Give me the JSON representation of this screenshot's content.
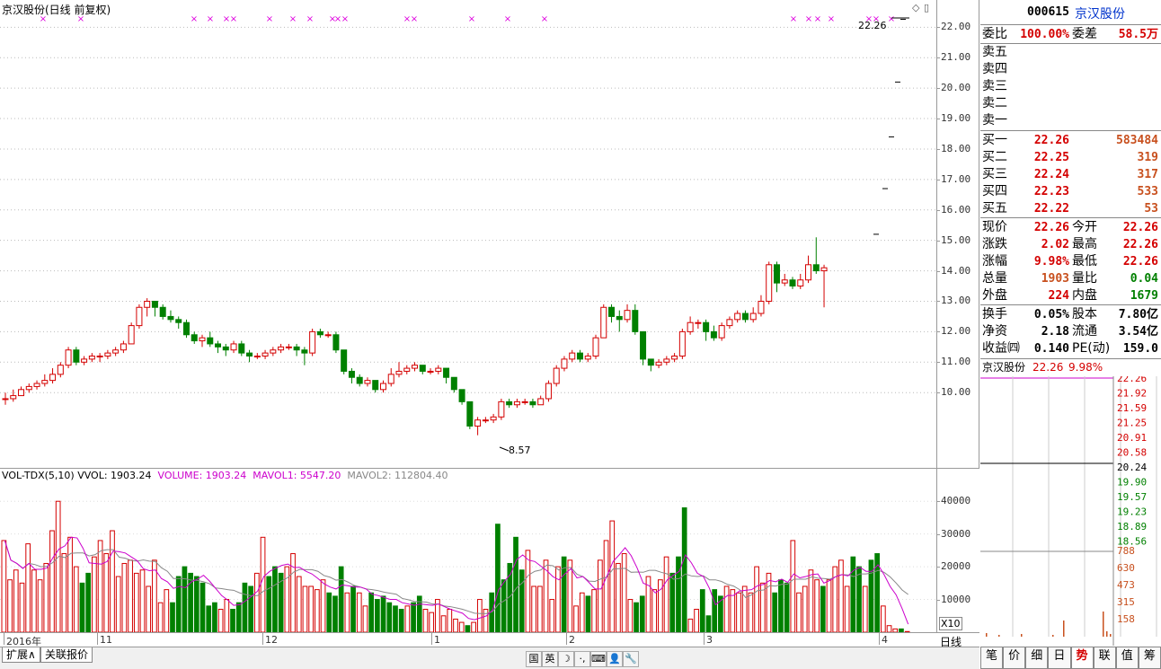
{
  "chart_title": "京汉股份(日线 前复权)",
  "price_ticks": [
    "22.00",
    "21.00",
    "20.00",
    "19.00",
    "18.00",
    "17.00",
    "16.00",
    "15.00",
    "14.00",
    "13.00",
    "12.00",
    "11.00",
    "10.00"
  ],
  "annot_high": "22.26",
  "annot_low": "8.57",
  "vol_header": {
    "title": "VOL-TDX(5,10)",
    "vvol": "VVOL: 1903.24",
    "volume": "VOLUME: 1903.24",
    "mavol1": "MAVOL1: 5547.20",
    "mavol2": "MAVOL2: 112804.40"
  },
  "vol_ticks": [
    "40000",
    "30000",
    "20000",
    "10000"
  ],
  "vol_unit": "X10",
  "x_labels": [
    "2016年",
    "11",
    "12",
    "1",
    "2",
    "3",
    "4"
  ],
  "day_label": "日线",
  "bottom_tabs": [
    "扩展∧",
    "关联报价"
  ],
  "tool_icons": [
    "国",
    "英",
    "☽",
    "·,",
    "⌨",
    "👤",
    "🔧"
  ],
  "stock": {
    "code": "000615",
    "name": "京汉股份"
  },
  "order_ratio": {
    "label1": "委比",
    "v1": "100.00%",
    "label2": "委差",
    "v2": "58.5万"
  },
  "asks": [
    {
      "label": "卖五"
    },
    {
      "label": "卖四"
    },
    {
      "label": "卖三"
    },
    {
      "label": "卖二"
    },
    {
      "label": "卖一"
    }
  ],
  "bids": [
    {
      "label": "买一",
      "price": "22.26",
      "vol": "583484"
    },
    {
      "label": "买二",
      "price": "22.25",
      "vol": "319"
    },
    {
      "label": "买三",
      "price": "22.24",
      "vol": "317"
    },
    {
      "label": "买四",
      "price": "22.23",
      "vol": "533"
    },
    {
      "label": "买五",
      "price": "22.22",
      "vol": "53"
    }
  ],
  "quote": [
    {
      "l1": "现价",
      "v1": "22.26",
      "c1": "red",
      "l2": "今开",
      "v2": "22.26",
      "c2": "red"
    },
    {
      "l1": "涨跌",
      "v1": "2.02",
      "c1": "red",
      "l2": "最高",
      "v2": "22.26",
      "c2": "red"
    },
    {
      "l1": "涨幅",
      "v1": "9.98%",
      "c1": "red",
      "l2": "最低",
      "v2": "22.26",
      "c2": "red"
    },
    {
      "l1": "总量",
      "v1": "1903",
      "c1": "orange",
      "l2": "量比",
      "v2": "0.04",
      "c2": "green"
    },
    {
      "l1": "外盘",
      "v1": "224",
      "c1": "red",
      "l2": "内盘",
      "v2": "1679",
      "c2": "green"
    }
  ],
  "finance": [
    {
      "l1": "换手",
      "v1": "0.05%",
      "l2": "股本",
      "v2": "7.80亿"
    },
    {
      "l1": "净资",
      "v1": "2.18",
      "l2": "流通",
      "v2": "3.54亿"
    },
    {
      "l1": "收益㈣",
      "v1": "0.140",
      "l2": "PE(动)",
      "v2": "159.0"
    }
  ],
  "mini": {
    "name": "京汉股份",
    "price": "22.26",
    "pct": "9.98%",
    "price_ticks": [
      "22.26",
      "21.92",
      "21.59",
      "21.25",
      "20.91",
      "20.58",
      "20.24",
      "19.90",
      "19.57",
      "19.23",
      "18.89",
      "18.56"
    ],
    "vol_ticks": [
      "788",
      "630",
      "473",
      "315",
      "158"
    ]
  },
  "side_tabs": [
    "笔",
    "价",
    "细",
    "日",
    "势",
    "联",
    "值",
    "筹"
  ],
  "side_tab_active": "势",
  "colors": {
    "up": "#d40000",
    "down": "#008000",
    "mavol1": "#cc00cc",
    "mavol2": "#888888",
    "marker": "#dd00dd"
  },
  "chart_data": {
    "type": "candlestick",
    "title": "京汉股份(日线 前复权)",
    "ylim": [
      8.0,
      22.6
    ],
    "y_ticks": [
      10,
      11,
      12,
      13,
      14,
      15,
      16,
      17,
      18,
      19,
      20,
      21,
      22
    ],
    "candles": [
      [
        9.8,
        9.8,
        10.0,
        9.6
      ],
      [
        9.8,
        9.9,
        10.1,
        9.7
      ],
      [
        9.9,
        10.1,
        10.2,
        9.9
      ],
      [
        10.1,
        10.2,
        10.3,
        10.0
      ],
      [
        10.2,
        10.3,
        10.4,
        10.1
      ],
      [
        10.3,
        10.4,
        10.6,
        10.2
      ],
      [
        10.4,
        10.6,
        10.8,
        10.3
      ],
      [
        10.6,
        10.9,
        11.0,
        10.5
      ],
      [
        10.9,
        11.4,
        11.5,
        10.8
      ],
      [
        11.4,
        11.0,
        11.5,
        10.9
      ],
      [
        11.0,
        11.1,
        11.2,
        10.9
      ],
      [
        11.1,
        11.2,
        11.3,
        11.0
      ],
      [
        11.2,
        11.2,
        11.3,
        11.0
      ],
      [
        11.2,
        11.3,
        11.4,
        11.1
      ],
      [
        11.3,
        11.4,
        11.5,
        11.2
      ],
      [
        11.4,
        11.6,
        11.7,
        11.3
      ],
      [
        11.6,
        12.2,
        12.3,
        11.6
      ],
      [
        12.2,
        12.8,
        12.9,
        12.1
      ],
      [
        12.8,
        13.0,
        13.1,
        12.5
      ],
      [
        13.0,
        12.8,
        13.0,
        12.5
      ],
      [
        12.8,
        12.5,
        12.9,
        12.4
      ],
      [
        12.5,
        12.4,
        12.7,
        12.3
      ],
      [
        12.4,
        12.3,
        12.5,
        12.1
      ],
      [
        12.3,
        11.9,
        12.4,
        11.8
      ],
      [
        11.9,
        11.7,
        12.0,
        11.6
      ],
      [
        11.7,
        11.8,
        11.9,
        11.5
      ],
      [
        11.8,
        11.6,
        12.0,
        11.5
      ],
      [
        11.6,
        11.5,
        11.7,
        11.3
      ],
      [
        11.5,
        11.4,
        11.6,
        11.2
      ],
      [
        11.4,
        11.6,
        11.7,
        11.3
      ],
      [
        11.6,
        11.3,
        11.7,
        11.2
      ],
      [
        11.3,
        11.2,
        11.4,
        11.0
      ],
      [
        11.2,
        11.2,
        11.3,
        11.1
      ],
      [
        11.2,
        11.3,
        11.4,
        11.1
      ],
      [
        11.3,
        11.4,
        11.5,
        11.2
      ],
      [
        11.4,
        11.5,
        11.6,
        11.3
      ],
      [
        11.5,
        11.5,
        11.6,
        11.4
      ],
      [
        11.5,
        11.4,
        11.6,
        11.2
      ],
      [
        11.4,
        11.3,
        11.5,
        10.9
      ],
      [
        11.3,
        12.0,
        12.1,
        11.2
      ],
      [
        12.0,
        11.9,
        12.1,
        11.8
      ],
      [
        11.9,
        11.9,
        12.0,
        11.8
      ],
      [
        11.9,
        11.4,
        12.0,
        11.3
      ],
      [
        11.4,
        10.7,
        11.4,
        10.6
      ],
      [
        10.7,
        10.5,
        10.8,
        10.3
      ],
      [
        10.5,
        10.3,
        10.6,
        10.2
      ],
      [
        10.3,
        10.4,
        10.5,
        10.2
      ],
      [
        10.4,
        10.1,
        10.4,
        10.0
      ],
      [
        10.1,
        10.3,
        10.4,
        10.0
      ],
      [
        10.3,
        10.6,
        10.8,
        10.2
      ],
      [
        10.6,
        10.7,
        11.0,
        10.5
      ],
      [
        10.7,
        10.8,
        10.9,
        10.6
      ],
      [
        10.8,
        10.9,
        11.0,
        10.7
      ],
      [
        10.9,
        10.7,
        10.9,
        10.6
      ],
      [
        10.7,
        10.7,
        10.8,
        10.6
      ],
      [
        10.7,
        10.8,
        10.9,
        10.6
      ],
      [
        10.8,
        10.5,
        10.8,
        10.3
      ],
      [
        10.5,
        10.1,
        10.5,
        10.0
      ],
      [
        10.1,
        9.7,
        10.1,
        9.6
      ],
      [
        9.7,
        8.9,
        9.7,
        8.8
      ],
      [
        8.9,
        9.1,
        9.2,
        8.6
      ],
      [
        9.1,
        9.1,
        9.2,
        9.0
      ],
      [
        9.1,
        9.2,
        9.3,
        9.0
      ],
      [
        9.2,
        9.7,
        9.8,
        9.1
      ],
      [
        9.7,
        9.6,
        9.8,
        9.5
      ],
      [
        9.6,
        9.7,
        9.8,
        9.5
      ],
      [
        9.7,
        9.7,
        9.8,
        9.6
      ],
      [
        9.7,
        9.6,
        9.8,
        9.5
      ],
      [
        9.6,
        9.8,
        9.9,
        9.6
      ],
      [
        9.8,
        10.3,
        10.4,
        9.7
      ],
      [
        10.3,
        10.8,
        10.9,
        10.2
      ],
      [
        10.8,
        11.1,
        11.2,
        10.7
      ],
      [
        11.1,
        11.3,
        11.4,
        11.0
      ],
      [
        11.3,
        11.1,
        11.4,
        11.0
      ],
      [
        11.1,
        11.2,
        11.3,
        11.0
      ],
      [
        11.2,
        11.8,
        11.9,
        11.1
      ],
      [
        11.8,
        12.8,
        12.9,
        11.8
      ],
      [
        12.8,
        12.5,
        12.9,
        12.3
      ],
      [
        12.5,
        12.4,
        12.7,
        12.0
      ],
      [
        12.4,
        12.7,
        12.9,
        12.3
      ],
      [
        12.7,
        12.0,
        12.9,
        11.9
      ],
      [
        12.0,
        11.1,
        12.0,
        10.9
      ],
      [
        11.1,
        10.9,
        11.1,
        10.7
      ],
      [
        10.9,
        11.0,
        11.1,
        10.8
      ],
      [
        11.0,
        11.1,
        11.2,
        10.9
      ],
      [
        11.1,
        11.2,
        11.3,
        11.0
      ],
      [
        11.2,
        12.0,
        12.1,
        11.1
      ],
      [
        12.0,
        12.3,
        12.5,
        11.9
      ],
      [
        12.3,
        12.3,
        12.4,
        12.1
      ],
      [
        12.3,
        12.0,
        12.4,
        11.7
      ],
      [
        12.0,
        11.8,
        12.2,
        11.7
      ],
      [
        11.8,
        12.2,
        12.3,
        11.7
      ],
      [
        12.2,
        12.4,
        12.5,
        12.1
      ],
      [
        12.4,
        12.6,
        12.7,
        12.3
      ],
      [
        12.6,
        12.4,
        12.7,
        12.3
      ],
      [
        12.4,
        12.6,
        12.8,
        12.3
      ],
      [
        12.6,
        13.0,
        13.2,
        12.5
      ],
      [
        13.0,
        14.2,
        14.3,
        12.9
      ],
      [
        14.2,
        13.6,
        14.3,
        13.3
      ],
      [
        13.6,
        13.7,
        13.9,
        13.5
      ],
      [
        13.7,
        13.5,
        13.8,
        13.4
      ],
      [
        13.5,
        13.7,
        13.9,
        13.4
      ],
      [
        13.7,
        14.2,
        14.5,
        13.6
      ],
      [
        14.2,
        14.0,
        15.1,
        13.9
      ],
      [
        14.0,
        14.1,
        14.2,
        12.8
      ]
    ],
    "lastpoint_marks": [
      15.2,
      16.7,
      18.4,
      20.2,
      22.26
    ],
    "volumes": [
      28,
      16,
      19,
      15,
      27,
      19,
      16,
      21,
      31,
      40,
      24,
      29,
      20,
      15,
      18,
      23,
      28,
      24,
      31,
      17,
      21,
      22,
      18,
      19,
      14,
      22,
      9,
      13,
      9,
      17,
      20,
      18,
      17,
      15,
      8,
      9,
      7,
      10,
      7,
      9,
      15,
      14,
      18,
      29,
      17,
      20,
      18,
      20,
      24,
      17,
      14,
      14,
      13,
      16,
      12,
      11,
      20,
      12,
      14,
      12,
      8,
      12,
      10,
      11,
      9,
      8,
      7,
      8,
      9,
      11,
      7,
      6,
      10,
      5,
      7,
      4,
      3,
      2,
      3,
      10,
      7,
      12,
      33,
      16,
      21,
      29,
      19,
      25,
      14,
      14,
      22,
      10,
      20,
      23,
      22,
      8,
      12,
      11,
      13,
      22,
      28,
      34,
      21,
      24,
      10,
      9,
      11,
      17,
      13,
      16,
      23,
      18,
      23,
      38,
      4,
      7,
      13,
      5,
      13,
      11,
      14,
      13,
      12,
      14,
      12,
      20,
      15,
      18,
      12,
      16,
      15,
      28,
      12,
      14,
      19,
      16,
      14,
      16,
      20,
      22,
      14,
      23,
      20,
      14,
      22,
      24,
      8,
      2,
      1,
      1,
      0.2
    ],
    "vol_ylim": [
      0,
      45000
    ]
  }
}
